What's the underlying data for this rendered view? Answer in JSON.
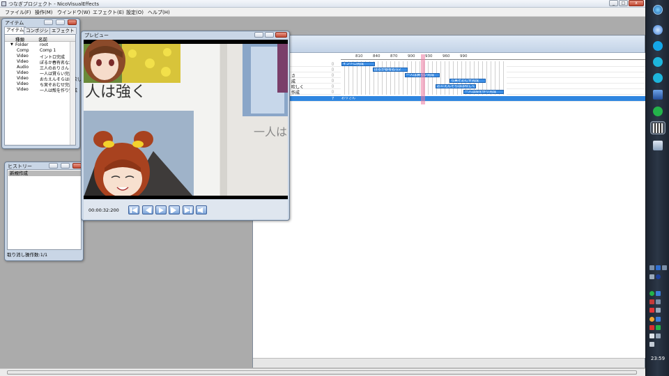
{
  "app": {
    "title": "つなぎプロジェクト - NicoVisualEffects",
    "window_controls": {
      "minimize": "_",
      "maximize": "□",
      "close": "x"
    }
  },
  "menu": [
    "ファイル(F)",
    "操作(M)",
    "ウインドウ(W)",
    "エフェクト(E)",
    "設定(O)",
    "ヘルプ(H)"
  ],
  "item_panel": {
    "title": "アイテム",
    "tabs": [
      "アイテム",
      "コンポジション",
      "エフェクト"
    ],
    "columns": [
      "種類",
      "名前"
    ],
    "rows": [
      {
        "type": "Folder",
        "name": "root",
        "expanded": true
      },
      {
        "type": "Comp",
        "name": "Comp 1"
      },
      {
        "type": "Video",
        "name": "イントロ完成"
      },
      {
        "type": "Video",
        "name": "ぽるか春有名な2"
      },
      {
        "type": "Audio",
        "name": "三人のおりさん"
      },
      {
        "type": "Video",
        "name": "一人は賢らい完成"
      },
      {
        "type": "Video",
        "name": "おたえんそらはは吹しく"
      },
      {
        "type": "Video",
        "name": "ち実ぞおむせ完成"
      },
      {
        "type": "Video",
        "name": "一人は殻を作り完成"
      }
    ]
  },
  "history_panel": {
    "title": "ヒストリー",
    "items": [
      "新規作成"
    ],
    "status": "取り消し操作数:1/1"
  },
  "preview_panel": {
    "title": "プレビュー",
    "timecode": "00:00:32:200",
    "caption_text_left": "人は強く",
    "caption_text_right": "一人は"
  },
  "composition": {
    "ruler_labels": [
      "810",
      "840",
      "870",
      "900",
      "930",
      "960",
      "990"
    ],
    "tracks": [
      {
        "label": "",
        "clip_text": "イントロ完成",
        "ctl": "▯"
      },
      {
        "label": "",
        "clip_text": "ぽるか春有名な2",
        "ctl": "▯"
      },
      {
        "label": "さ",
        "clip_text": "一人は賢らい完成",
        "ctl": "▯"
      },
      {
        "label": "成",
        "clip_text": "ち実ぞおむせ完成",
        "ctl": "▯"
      },
      {
        "label": "吹しく",
        "clip_text": "おたえんそらはは吹しく",
        "ctl": "▯"
      },
      {
        "label": "作成",
        "clip_text": "一人は殻を作り完成",
        "ctl": "▯"
      },
      {
        "label": "",
        "clip_text": "おりさん",
        "ctl": "7"
      }
    ]
  },
  "taskbar": {
    "clock": "23:59"
  }
}
